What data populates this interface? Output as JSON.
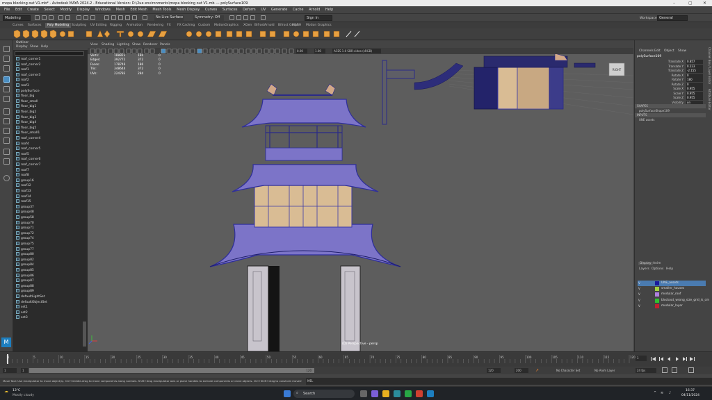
{
  "window": {
    "title": "mopa blocking out V1.mb* - Autodesk MAYA 2024.2 - Educational Version: D:\\2ue environments\\mopa blocking out V1.mb --- polySurface109"
  },
  "menubar": [
    "File",
    "Edit",
    "Create",
    "Select",
    "Modify",
    "Display",
    "Windows",
    "Mesh",
    "Edit Mesh",
    "Mesh Tools",
    "Mesh Display",
    "Curves",
    "Surfaces",
    "Deform",
    "UV",
    "Generate",
    "Cache",
    "Arnold",
    "Help"
  ],
  "status": {
    "mode": "Modeling",
    "live": "No Live Surface",
    "symmetry": "Symmetry: Off",
    "signin": "Sign In",
    "workspace_label": "Workspace :",
    "workspace": "General"
  },
  "shelf_tabs": [
    "Curves",
    "Surfaces",
    "Poly Modeling",
    "Sculpting",
    "UV Editing",
    "Rigging",
    "Animation",
    "Rendering",
    "FX",
    "FX Caching",
    "Custom",
    "MotionGraphics",
    "XGen",
    "Bifrost",
    "Arnold",
    "Bifrost Graph",
    "MASH",
    "Motion Graphics"
  ],
  "shelf_active": "Poly Modeling",
  "outliner": {
    "title": "Outliner",
    "menu": [
      "Display",
      "Show",
      "Help"
    ],
    "items": [
      "roof_corner1",
      "roof_corner2",
      "roof1",
      "roof_corner3",
      "roof2",
      "roof3",
      "polySurface",
      "floor_big",
      "floor_small",
      "floor_big1",
      "floor_big2",
      "floor_big3",
      "floor_big4",
      "floor_big5",
      "floor_small1",
      "roof_corner4",
      "roof4",
      "roof_corner5",
      "roof5",
      "roof_corner6",
      "roof_corner7",
      "roof7",
      "roof8",
      "group16",
      "roof12",
      "roof13",
      "roof14",
      "roof15",
      "group37",
      "group48",
      "group58",
      "group70",
      "group71",
      "group72",
      "group74",
      "group75",
      "group77",
      "group80",
      "group82",
      "group84",
      "group85",
      "group86",
      "group87",
      "group88",
      "group89",
      "defaultLightSet",
      "defaultObjectSet",
      "set1",
      "set2",
      "set3"
    ]
  },
  "viewport": {
    "menu": [
      "View",
      "Shading",
      "Lighting",
      "Show",
      "Renderer",
      "Panels"
    ],
    "hud": {
      "labels": [
        "Verts:",
        "Edges:",
        "Faces:",
        "Tris:",
        "UVs:"
      ],
      "col1": [
        "188823",
        "392772",
        "178746",
        "348644",
        "224783"
      ],
      "col2": [
        "186",
        "372",
        "186",
        "372",
        "284"
      ],
      "col3": [
        "0",
        "0",
        "0",
        "0",
        "0"
      ]
    },
    "camera": "(D) Perspective - persp",
    "cube": "RIGHT",
    "exposure": "0.00",
    "gamma": "1.00",
    "colorspace": "ACES 1.0 SDR-video (sRGB)"
  },
  "channelbox": {
    "tabs": [
      "Channels",
      "Edit",
      "Object",
      "Show"
    ],
    "object": "polySurface109",
    "attrs": [
      [
        "Translate X",
        "0.857"
      ],
      [
        "Translate Y",
        "0.223"
      ],
      [
        "Translate Z",
        "-2.155"
      ],
      [
        "Rotate X",
        "0"
      ],
      [
        "Rotate Y",
        "180"
      ],
      [
        "Rotate Z",
        "0"
      ],
      [
        "Scale X",
        "0.955"
      ],
      [
        "Scale Y",
        "0.955"
      ],
      [
        "Scale Z",
        "0.955"
      ],
      [
        "Visibility",
        "on"
      ]
    ],
    "shapes_label": "SHAPES",
    "shape": "polySurfaceShape109",
    "inputs_label": "INPUTS",
    "input": "UNE assets"
  },
  "layers": {
    "tabs": [
      "Display",
      "Anim"
    ],
    "menu": [
      "Layers",
      "Options",
      "Help"
    ],
    "items": [
      {
        "name": "UNE_assets",
        "color": "#1a1a9c"
      },
      {
        "name": "smaller_houses",
        "color": "#a0d040"
      },
      {
        "name": "modular_roof",
        "color": "#b080e0"
      },
      {
        "name": "blockout_wrong_size_grid_is_cm",
        "color": "#30c030"
      },
      {
        "name": "modular_layer",
        "color": "#c02030"
      }
    ]
  },
  "timeline": {
    "ticks": [
      "1",
      "5",
      "10",
      "15",
      "20",
      "25",
      "30",
      "35",
      "40",
      "45",
      "50",
      "55",
      "60",
      "65",
      "70",
      "75",
      "80",
      "85",
      "90",
      "95",
      "100",
      "105",
      "110",
      "115",
      "120"
    ],
    "current": "1",
    "start": "1",
    "end": "120",
    "range_start": "1",
    "range_end": "120",
    "max": "200",
    "char_set": "No Character Set",
    "anim_layer": "No Anim Layer",
    "fps": "24 fps"
  },
  "helpline": "Move Tool: Use manipulator to move object(s). Ctrl+middle-drag to move components along normals. Shift+drag manipulator axis or plane handles to extrude components or clone objects. Ctrl+Shift+drag to constrain movement to a co...",
  "cmd_label": "MEL",
  "taskbar": {
    "temp": "13°C",
    "weather": "Mostly cloudy",
    "search": "Search",
    "time": "16:37",
    "date": "04/11/2024"
  },
  "colors": {
    "wire": "#3a3aa8",
    "tile": "#7c74c8",
    "wall": "#d9bc94",
    "pillar": "#c8c4cc"
  }
}
